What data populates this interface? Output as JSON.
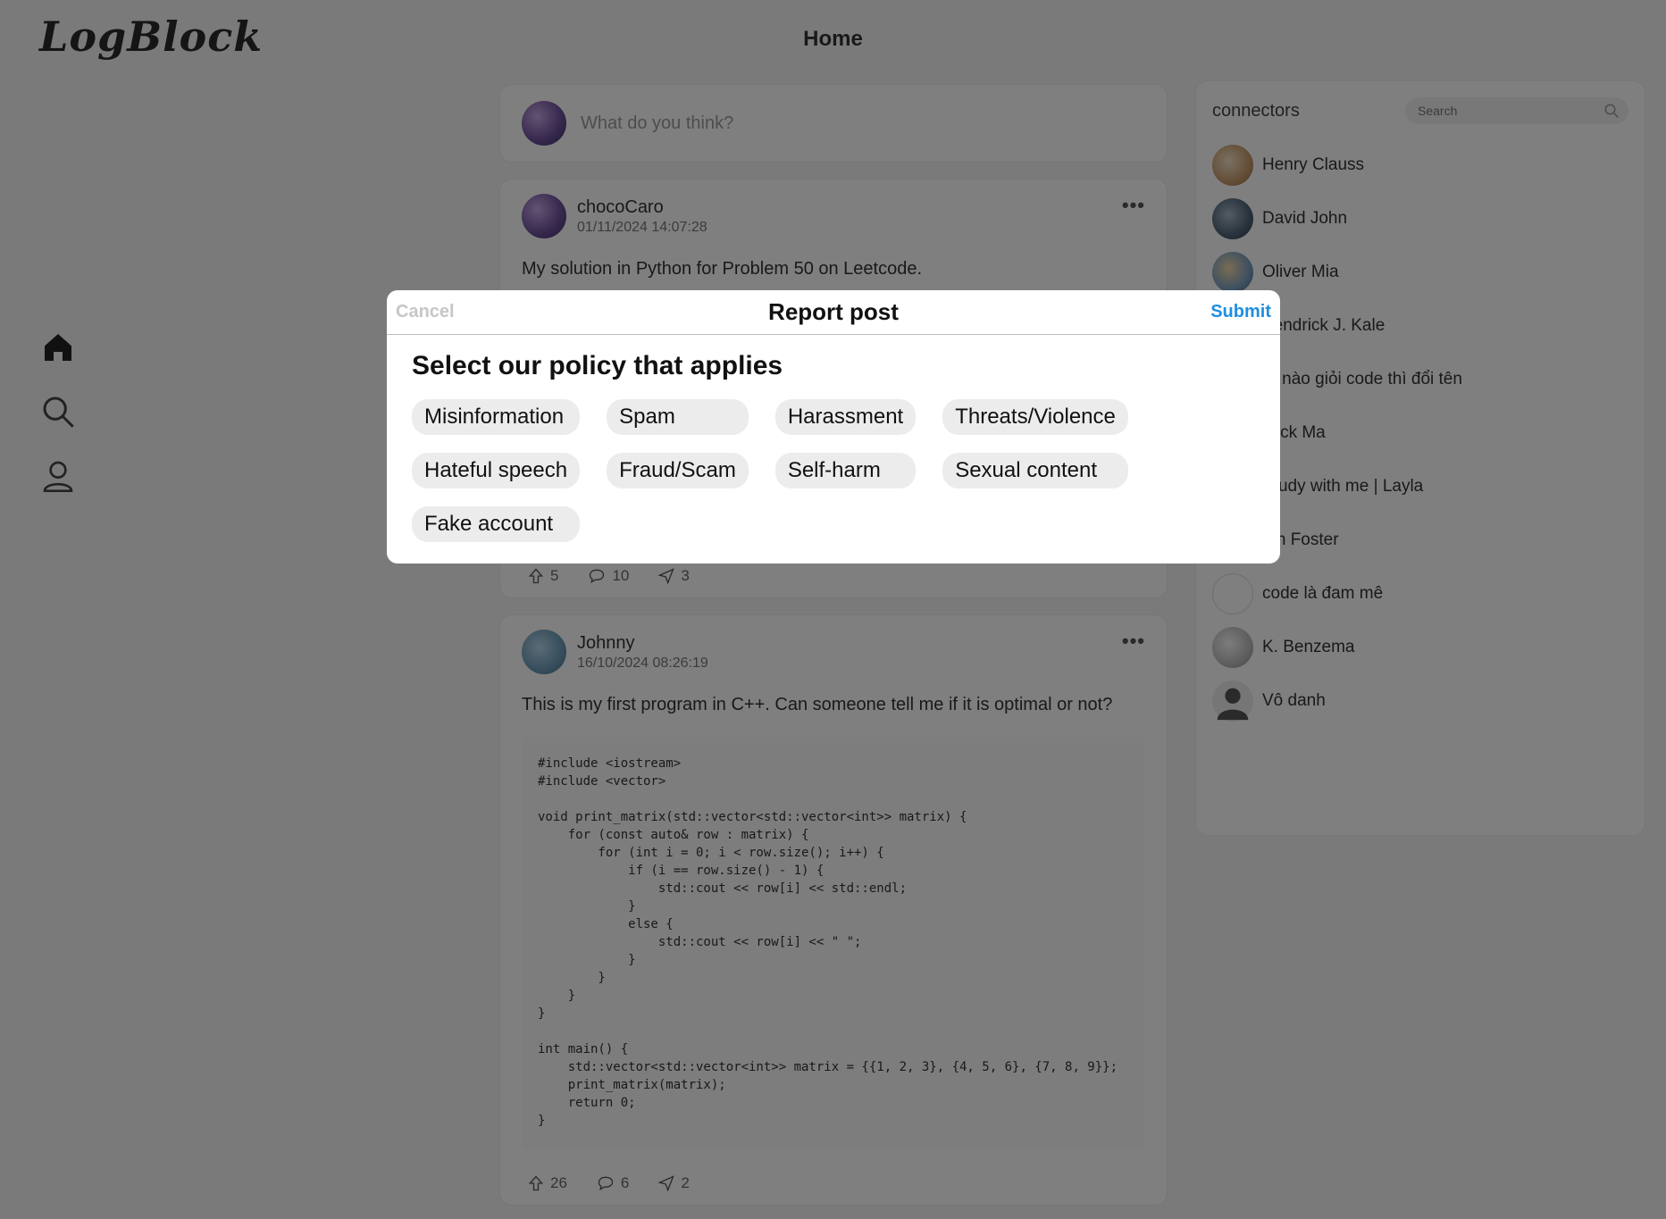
{
  "app": {
    "logo": "LogBlock",
    "page_title": "Home"
  },
  "nav": {
    "items": [
      {
        "icon": "home-icon"
      },
      {
        "icon": "search-icon"
      },
      {
        "icon": "profile-icon"
      }
    ]
  },
  "composer": {
    "placeholder": "What do you think?"
  },
  "posts": [
    {
      "user": "chocoCaro",
      "date": "01/11/2024 14:07:28",
      "text": "My solution in Python for Problem 50 on Leetcode.",
      "upvotes": "5",
      "comments": "10",
      "shares": "3"
    },
    {
      "user": "Johnny",
      "date": "16/10/2024 08:26:19",
      "text": "This is my first program in C++. Can someone tell me if it is optimal or not?",
      "code": "#include <iostream>\n#include <vector>\n\nvoid print_matrix(std::vector<std::vector<int>> matrix) {\n    for (const auto& row : matrix) {\n        for (int i = 0; i < row.size(); i++) {\n            if (i == row.size() - 1) {\n                std::cout << row[i] << std::endl;\n            }\n            else {\n                std::cout << row[i] << \" \";\n            }\n        }\n    }\n}\n\nint main() {\n    std::vector<std::vector<int>> matrix = {{1, 2, 3}, {4, 5, 6}, {7, 8, 9}};\n    print_matrix(matrix);\n    return 0;\n}",
      "upvotes": "26",
      "comments": "6",
      "shares": "2"
    }
  ],
  "connectors": {
    "title": "connectors",
    "search_placeholder": "Search",
    "items": [
      {
        "name": "Henry Clauss"
      },
      {
        "name": "David John"
      },
      {
        "name": "Oliver Mia"
      },
      {
        "name": "Kendrick J. Kale"
      },
      {
        "name": "Ai nào giỏi code thì đổi tên"
      },
      {
        "name": "Jack Ma"
      },
      {
        "name": "Study with me | Layla"
      },
      {
        "name": "Ian Foster"
      },
      {
        "name": "code là đam mê"
      },
      {
        "name": "K. Benzema"
      },
      {
        "name": "Vô danh"
      }
    ]
  },
  "modal": {
    "cancel_label": "Cancel",
    "title": "Report post",
    "submit_label": "Submit",
    "subtitle": "Select our policy that applies",
    "options": [
      "Misinformation",
      "Spam",
      "Harassment",
      "Threats/Violence",
      "Hateful speech",
      "Fraud/Scam",
      "Self-harm",
      "Sexual content",
      "Fake account"
    ]
  },
  "colors": {
    "submit": "#1e8fe1",
    "cancel": "#c6c6c6",
    "chip_bg": "#ececec",
    "overlay": "rgba(0,0,0,0.5)"
  }
}
